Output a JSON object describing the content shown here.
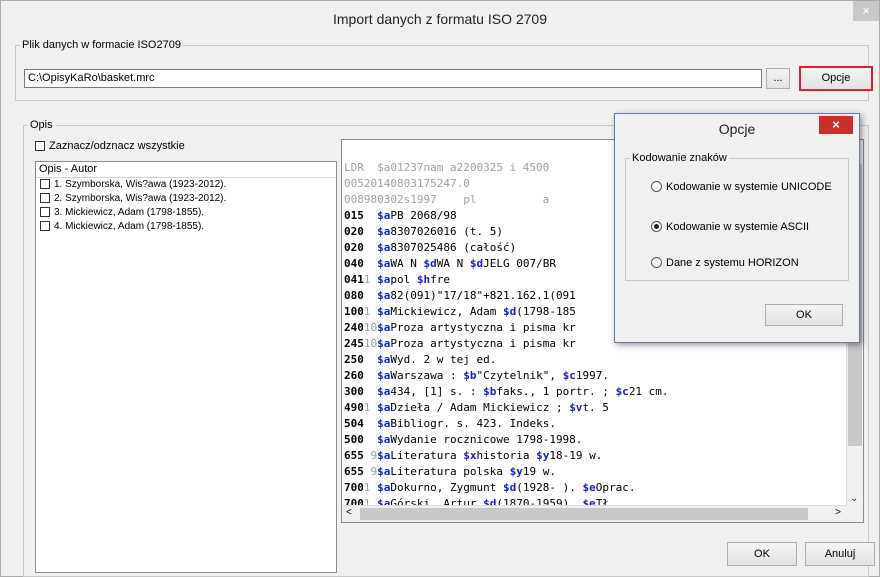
{
  "window": {
    "title": "Import danych z formatu ISO 2709",
    "close_label": "×"
  },
  "file_group": {
    "legend": "Plik danych w formacie ISO2709",
    "path_value": "C:\\OpisyKaRo\\basket.mrc",
    "browse_label": "...",
    "options_label": "Opcje"
  },
  "desc_group": {
    "legend": "Opis",
    "select_all_label": "Zaznacz/odznacz wszystkie",
    "list_header": "Opis - Autor",
    "items": [
      "1. Szymborska, Wis?awa (1923-2012).",
      "2. Szymborska, Wis?awa (1923-2012).",
      "3. Mickiewicz, Adam (1798-1855).",
      "4. Mickiewicz, Adam (1798-1855)."
    ]
  },
  "marc_lines": [
    [
      [
        "gr",
        "LDR  $a01237nam a2200325 i 4500"
      ]
    ],
    [
      [
        "gr",
        "00520140803175247.0"
      ]
    ],
    [
      [
        "gr",
        "008980302s1997    pl          a"
      ]
    ],
    [
      [
        "tag",
        "015  "
      ],
      [
        "sf",
        "$a"
      ],
      [
        "t",
        "PB 2068/98"
      ]
    ],
    [
      [
        "tag",
        "020  "
      ],
      [
        "sf",
        "$a"
      ],
      [
        "t",
        "8307026016 (t. 5)"
      ]
    ],
    [
      [
        "tag",
        "020  "
      ],
      [
        "sf",
        "$a"
      ],
      [
        "t",
        "8307025486 (całość)"
      ]
    ],
    [
      [
        "tag",
        "040  "
      ],
      [
        "sf",
        "$a"
      ],
      [
        "t",
        "WA N "
      ],
      [
        "sf",
        "$d"
      ],
      [
        "t",
        "WA N "
      ],
      [
        "sf",
        "$d"
      ],
      [
        "t",
        "JELG 007/BR"
      ]
    ],
    [
      [
        "tag",
        "041"
      ],
      [
        "gr",
        "1 "
      ],
      [
        "sf",
        "$a"
      ],
      [
        "t",
        "pol "
      ],
      [
        "sf",
        "$h"
      ],
      [
        "t",
        "fre"
      ]
    ],
    [
      [
        "tag",
        "080  "
      ],
      [
        "sf",
        "$a"
      ],
      [
        "t",
        "82(091)\"17/18\"+821.162.1(091"
      ]
    ],
    [
      [
        "tag",
        "100"
      ],
      [
        "gr",
        "1 "
      ],
      [
        "sf",
        "$a"
      ],
      [
        "t",
        "Mickiewicz, Adam "
      ],
      [
        "sf",
        "$d"
      ],
      [
        "t",
        "(1798-185"
      ]
    ],
    [
      [
        "tag",
        "240"
      ],
      [
        "gr",
        "10"
      ],
      [
        "sf",
        "$a"
      ],
      [
        "t",
        "Proza artystyczna i pisma kr"
      ]
    ],
    [
      [
        "tag",
        "245"
      ],
      [
        "gr",
        "10"
      ],
      [
        "sf",
        "$a"
      ],
      [
        "t",
        "Proza artystyczna i pisma kr"
      ]
    ],
    [
      [
        "tag",
        "250  "
      ],
      [
        "sf",
        "$a"
      ],
      [
        "t",
        "Wyd. 2 w tej ed."
      ]
    ],
    [
      [
        "tag",
        "260  "
      ],
      [
        "sf",
        "$a"
      ],
      [
        "t",
        "Warszawa : "
      ],
      [
        "sf",
        "$b"
      ],
      [
        "t",
        "\"Czytelnik\", "
      ],
      [
        "sf",
        "$c"
      ],
      [
        "t",
        "1997."
      ]
    ],
    [
      [
        "tag",
        "300  "
      ],
      [
        "sf",
        "$a"
      ],
      [
        "t",
        "434, [1] s. : "
      ],
      [
        "sf",
        "$b"
      ],
      [
        "t",
        "faks., 1 portr. ; "
      ],
      [
        "sf",
        "$c"
      ],
      [
        "t",
        "21 cm."
      ]
    ],
    [
      [
        "tag",
        "490"
      ],
      [
        "gr",
        "1 "
      ],
      [
        "sf",
        "$a"
      ],
      [
        "t",
        "Dzieła / Adam Mickiewicz ; "
      ],
      [
        "sf",
        "$v"
      ],
      [
        "t",
        "t. 5"
      ]
    ],
    [
      [
        "tag",
        "504  "
      ],
      [
        "sf",
        "$a"
      ],
      [
        "t",
        "Bibliogr. s. 423. Indeks."
      ]
    ],
    [
      [
        "tag",
        "500  "
      ],
      [
        "sf",
        "$a"
      ],
      [
        "t",
        "Wydanie rocznicowe 1798-1998."
      ]
    ],
    [
      [
        "tag",
        "655 "
      ],
      [
        "gr",
        "9"
      ],
      [
        "sf",
        "$a"
      ],
      [
        "t",
        "Literatura "
      ],
      [
        "sf",
        "$x"
      ],
      [
        "t",
        "historia "
      ],
      [
        "sf",
        "$y"
      ],
      [
        "t",
        "18-19 w."
      ]
    ],
    [
      [
        "tag",
        "655 "
      ],
      [
        "gr",
        "9"
      ],
      [
        "sf",
        "$a"
      ],
      [
        "t",
        "Literatura polska "
      ],
      [
        "sf",
        "$y"
      ],
      [
        "t",
        "19 w."
      ]
    ],
    [
      [
        "tag",
        "700"
      ],
      [
        "gr",
        "1 "
      ],
      [
        "sf",
        "$a"
      ],
      [
        "t",
        "Dokurno, Zygmunt "
      ],
      [
        "sf",
        "$d"
      ],
      [
        "t",
        "(1928- ). "
      ],
      [
        "sf",
        "$e"
      ],
      [
        "t",
        "Oprac."
      ]
    ],
    [
      [
        "tag",
        "700"
      ],
      [
        "gr",
        "1 "
      ],
      [
        "sf",
        "$a"
      ],
      [
        "t",
        "Górski, Artur "
      ],
      [
        "sf",
        "$d"
      ],
      [
        "t",
        "(1870-1959). "
      ],
      [
        "sf",
        "$e"
      ],
      [
        "t",
        "Tł."
      ]
    ]
  ],
  "options_dialog": {
    "title": "Opcje",
    "close_label": "×",
    "group_label": "Kodowanie znaków",
    "options": [
      {
        "label": "Kodowanie w systemie UNICODE",
        "selected": false
      },
      {
        "label": "Kodowanie w systemie ASCII",
        "selected": true
      },
      {
        "label": "Dane z systemu HORIZON",
        "selected": false
      }
    ],
    "ok_label": "OK"
  },
  "footer": {
    "ok_label": "OK",
    "cancel_label": "Anuluj"
  },
  "colors": {
    "highlight_border": "#e0202a",
    "subfield": "#1a1ad8",
    "indicator": "#a0a0a0",
    "dialog_close": "#c9302c"
  }
}
